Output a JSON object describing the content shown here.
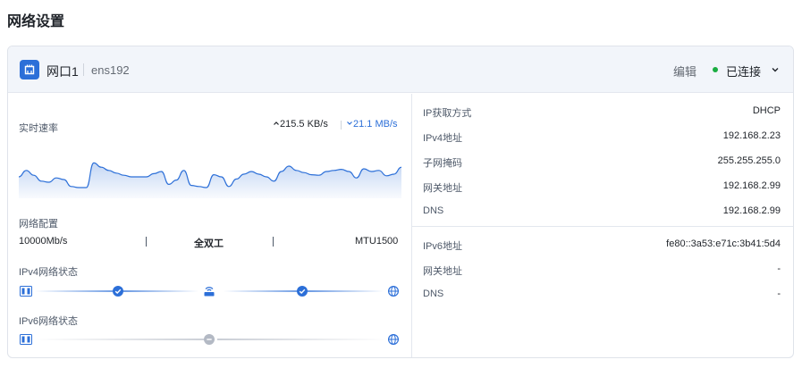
{
  "page_title": "网络设置",
  "port": {
    "name": "网口1",
    "device": "ens192",
    "edit_label": "编辑",
    "status": "已连接"
  },
  "speed": {
    "label": "实时速率",
    "upload": "215.5 KB/s",
    "download": "21.1 MB/s",
    "sparkline": [
      0.4,
      0.52,
      0.43,
      0.32,
      0.3,
      0.38,
      0.35,
      0.22,
      0.2,
      0.2,
      0.66,
      0.58,
      0.52,
      0.47,
      0.43,
      0.4,
      0.4,
      0.4,
      0.46,
      0.5,
      0.26,
      0.34,
      0.52,
      0.24,
      0.22,
      0.2,
      0.44,
      0.4,
      0.22,
      0.36,
      0.45,
      0.5,
      0.45,
      0.4,
      0.32,
      0.5,
      0.6,
      0.52,
      0.48,
      0.44,
      0.43,
      0.5,
      0.52,
      0.54,
      0.5,
      0.38,
      0.55,
      0.5,
      0.52,
      0.42,
      0.45,
      0.58
    ]
  },
  "config": {
    "label": "网络配置",
    "speed": "10000Mb/s",
    "duplex": "全双工",
    "mtu": "MTU1500"
  },
  "ipv4_status": {
    "label": "IPv4网络状态"
  },
  "ipv6_status": {
    "label": "IPv6网络状态"
  },
  "ipv4": [
    {
      "label": "IP获取方式",
      "value": "DHCP"
    },
    {
      "label": "IPv4地址",
      "value": "192.168.2.23"
    },
    {
      "label": "子网掩码",
      "value": "255.255.255.0"
    },
    {
      "label": "网关地址",
      "value": "192.168.2.99"
    },
    {
      "label": "DNS",
      "value": "192.168.2.99"
    }
  ],
  "ipv6": [
    {
      "label": "IPv6地址",
      "value": "fe80::3a53:e71c:3b41:5d4"
    },
    {
      "label": "网关地址",
      "value": "-"
    },
    {
      "label": "DNS",
      "value": "-"
    }
  ],
  "colors": {
    "accent": "#2c6fd8",
    "connected": "#1aad41",
    "inactive": "#b3b9c4"
  }
}
